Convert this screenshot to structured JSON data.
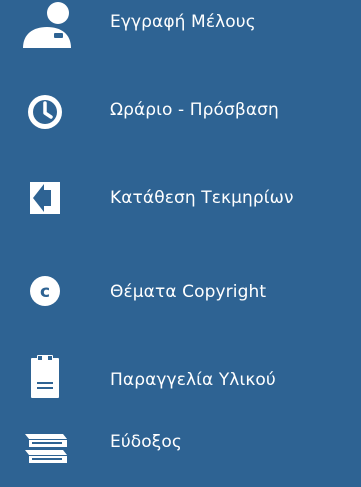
{
  "colors": {
    "background": "#2e6393",
    "foreground": "#ffffff"
  },
  "menu": {
    "items": [
      {
        "label": "Εγγραφή Μέλους",
        "icon": "user-icon"
      },
      {
        "label": "Ωράριο - Πρόσβαση",
        "icon": "clock-icon"
      },
      {
        "label": "Κατάθεση Τεκμηρίων",
        "icon": "arrow-left-icon"
      },
      {
        "label": "Θέματα Copyright",
        "icon": "copyright-icon"
      },
      {
        "label": "Παραγγελία Υλικού",
        "icon": "clipboard-icon"
      },
      {
        "label": "Εύδοξος",
        "icon": "books-icon"
      }
    ]
  }
}
